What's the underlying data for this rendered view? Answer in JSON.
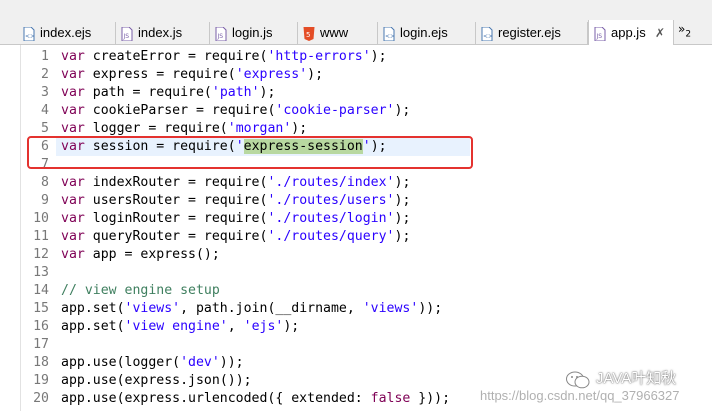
{
  "tabs": [
    {
      "label": "index.ejs",
      "icon": "ejs-file-icon",
      "active": false
    },
    {
      "label": "index.js",
      "icon": "js-file-icon",
      "active": false
    },
    {
      "label": "login.js",
      "icon": "js-file-icon",
      "active": false
    },
    {
      "label": "www",
      "icon": "html5-file-icon",
      "active": false
    },
    {
      "label": "login.ejs",
      "icon": "ejs-file-icon",
      "active": false
    },
    {
      "label": "register.ejs",
      "icon": "ejs-file-icon",
      "active": false
    },
    {
      "label": "app.js",
      "icon": "js-file-icon",
      "active": true
    }
  ],
  "tab_close": "✗",
  "overflow": {
    "chevron": "»",
    "count": "2"
  },
  "lines": [
    {
      "n": "1",
      "tokens": [
        [
          "kw",
          "var"
        ],
        [
          "t",
          " createError = require("
        ],
        [
          "str",
          "'http-errors'"
        ],
        [
          "t",
          ");"
        ]
      ]
    },
    {
      "n": "2",
      "tokens": [
        [
          "kw",
          "var"
        ],
        [
          "t",
          " express = require("
        ],
        [
          "str",
          "'express'"
        ],
        [
          "t",
          ");"
        ]
      ]
    },
    {
      "n": "3",
      "tokens": [
        [
          "kw",
          "var"
        ],
        [
          "t",
          " path = require("
        ],
        [
          "str",
          "'path'"
        ],
        [
          "t",
          ");"
        ]
      ]
    },
    {
      "n": "4",
      "tokens": [
        [
          "kw",
          "var"
        ],
        [
          "t",
          " cookieParser = require("
        ],
        [
          "str",
          "'cookie-parser'"
        ],
        [
          "t",
          ");"
        ]
      ]
    },
    {
      "n": "5",
      "tokens": [
        [
          "kw",
          "var"
        ],
        [
          "t",
          " logger = require("
        ],
        [
          "str",
          "'morgan'"
        ],
        [
          "t",
          ");"
        ]
      ]
    },
    {
      "n": "6",
      "tokens": [
        [
          "kw",
          "var"
        ],
        [
          "t",
          " session = require("
        ],
        [
          "str",
          "'"
        ],
        [
          "mark",
          "express-session"
        ],
        [
          "str",
          "'"
        ],
        [
          "t",
          ");"
        ]
      ]
    },
    {
      "n": "7",
      "tokens": []
    },
    {
      "n": "8",
      "tokens": [
        [
          "kw",
          "var"
        ],
        [
          "t",
          " indexRouter = require("
        ],
        [
          "str",
          "'./routes/index'"
        ],
        [
          "t",
          ");"
        ]
      ]
    },
    {
      "n": "9",
      "tokens": [
        [
          "kw",
          "var"
        ],
        [
          "t",
          " usersRouter = require("
        ],
        [
          "str",
          "'./routes/users'"
        ],
        [
          "t",
          ");"
        ]
      ]
    },
    {
      "n": "10",
      "tokens": [
        [
          "kw",
          "var"
        ],
        [
          "t",
          " loginRouter = require("
        ],
        [
          "str",
          "'./routes/login'"
        ],
        [
          "t",
          ");"
        ]
      ]
    },
    {
      "n": "11",
      "tokens": [
        [
          "kw",
          "var"
        ],
        [
          "t",
          " queryRouter = require("
        ],
        [
          "str",
          "'./routes/query'"
        ],
        [
          "t",
          ");"
        ]
      ]
    },
    {
      "n": "12",
      "tokens": [
        [
          "kw",
          "var"
        ],
        [
          "t",
          " app = express();"
        ]
      ]
    },
    {
      "n": "13",
      "tokens": []
    },
    {
      "n": "14",
      "tokens": [
        [
          "cm",
          "// view engine setup"
        ]
      ]
    },
    {
      "n": "15",
      "tokens": [
        [
          "t",
          "app.set("
        ],
        [
          "str",
          "'views'"
        ],
        [
          "t",
          ", path.join(__dirname, "
        ],
        [
          "str",
          "'views'"
        ],
        [
          "t",
          "));"
        ]
      ]
    },
    {
      "n": "16",
      "tokens": [
        [
          "t",
          "app.set("
        ],
        [
          "str",
          "'view engine'"
        ],
        [
          "t",
          ", "
        ],
        [
          "str",
          "'ejs'"
        ],
        [
          "t",
          ");"
        ]
      ]
    },
    {
      "n": "17",
      "tokens": []
    },
    {
      "n": "18",
      "tokens": [
        [
          "t",
          "app.use(logger("
        ],
        [
          "str",
          "'dev'"
        ],
        [
          "t",
          "));"
        ]
      ]
    },
    {
      "n": "19",
      "tokens": [
        [
          "t",
          "app.use(express."
        ],
        [
          "fn",
          "json"
        ],
        [
          "t",
          "());"
        ]
      ]
    },
    {
      "n": "20",
      "tokens": [
        [
          "t",
          "app.use(express.urlencoded({ extended: "
        ],
        [
          "kw",
          "false"
        ],
        [
          "t",
          " }));"
        ]
      ]
    }
  ],
  "watermark": {
    "brand": "JAVA叶知秋",
    "url": "https://blog.csdn.net/qq_37966327"
  },
  "colors": {
    "keyword": "#7f0055",
    "string": "#2a00ff",
    "comment": "#3f7f5f",
    "annotation_box": "#e4322f",
    "match_highlight": "#b8d8a0"
  }
}
